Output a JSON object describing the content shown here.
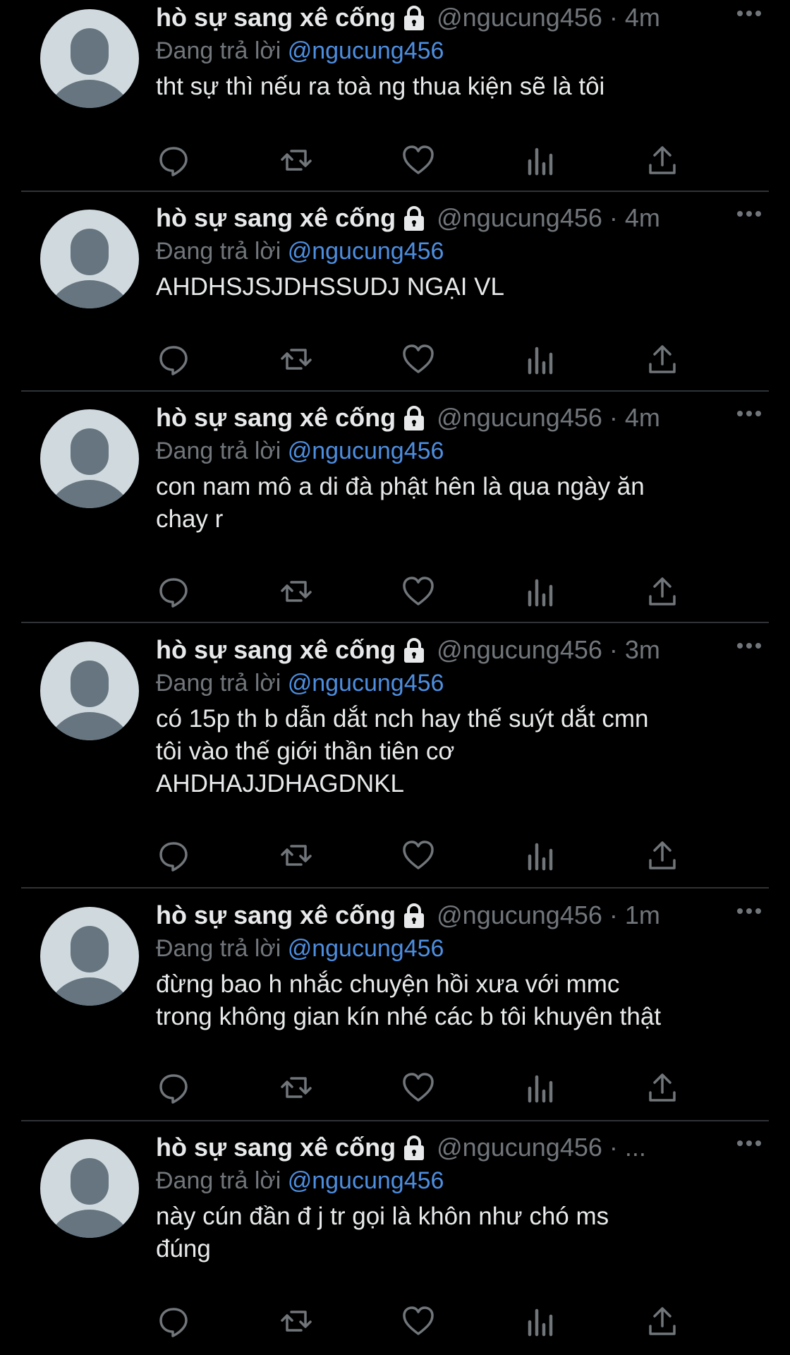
{
  "tweets": [
    {
      "name": "hò sự sang xê cống",
      "handle": "@ngucung456",
      "separator": "·",
      "time": "4m",
      "reply_prefix": "Đang trả lời",
      "reply_to": "@ngucung456",
      "text": "tht sự thì nếu ra toà ng thua kiện sẽ là tôi"
    },
    {
      "name": "hò sự sang xê cống",
      "handle": "@ngucung456",
      "separator": "·",
      "time": "4m",
      "reply_prefix": "Đang trả lời",
      "reply_to": "@ngucung456",
      "text": "AHDHSJSJDHSSUDJ NGẠI VL"
    },
    {
      "name": "hò sự sang xê cống",
      "handle": "@ngucung456",
      "separator": "·",
      "time": "4m",
      "reply_prefix": "Đang trả lời",
      "reply_to": "@ngucung456",
      "text": "con nam mô a di đà phật hên là qua ngày ăn\nchay r"
    },
    {
      "name": "hò sự sang xê cống",
      "handle": "@ngucung456",
      "separator": "·",
      "time": "3m",
      "reply_prefix": "Đang trả lời",
      "reply_to": "@ngucung456",
      "text": "có 15p th b dẫn dắt nch hay thế suýt dắt cmn\ntôi vào thế giới thần tiên cơ\nAHDHAJJDHAGDNKL"
    },
    {
      "name": "hò sự sang xê cống",
      "handle": "@ngucung456",
      "separator": "·",
      "time": "1m",
      "reply_prefix": "Đang trả lời",
      "reply_to": "@ngucung456",
      "text": "đừng bao h nhắc chuyện hồi xưa với mmc\ntrong không gian kín nhé các b tôi khuyên thật"
    },
    {
      "name": "hò sự sang xê cống",
      "handle": "@ngucung456",
      "separator": "·",
      "time": "...",
      "reply_prefix": "Đang trả lời",
      "reply_to": "@ngucung456",
      "text": "này cún đần đ j tr gọi là khôn như chó ms\nđúng"
    }
  ],
  "icons": {
    "lock": "lock-icon",
    "more": "more-icon",
    "reply": "reply-icon",
    "retweet": "retweet-icon",
    "like": "like-icon",
    "views": "views-icon",
    "share": "share-icon"
  },
  "colors": {
    "background": "#000000",
    "text": "#e7e9ea",
    "secondary": "#71767b",
    "mention": "#4d8ee0",
    "divider": "#2f3336",
    "avatar_bg": "#cfd9de",
    "avatar_fg": "#66757f"
  }
}
